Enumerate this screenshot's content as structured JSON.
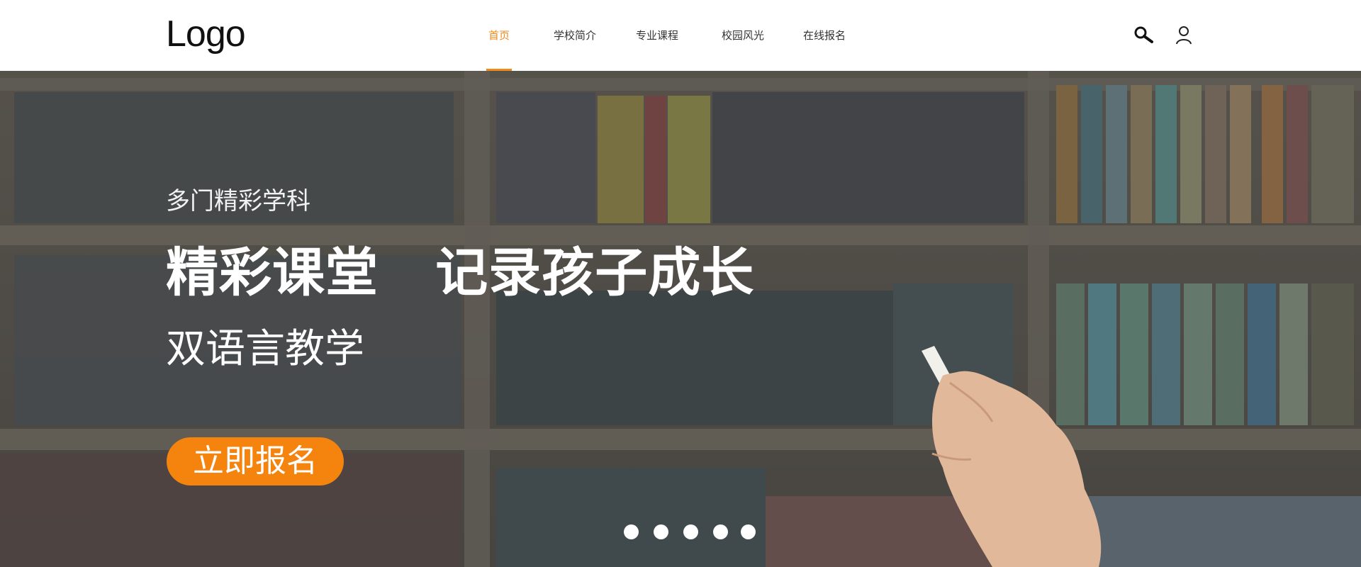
{
  "header": {
    "logo": "Logo",
    "nav": [
      {
        "label": "首页",
        "active": true
      },
      {
        "label": "学校简介",
        "active": false
      },
      {
        "label": "专业课程",
        "active": false
      },
      {
        "label": "校园风光",
        "active": false
      },
      {
        "label": "在线报名",
        "active": false
      }
    ],
    "icons": [
      "search-icon",
      "user-icon"
    ]
  },
  "hero": {
    "subtitle": "多门精彩学科",
    "title": "精彩课堂   记录孩子成长",
    "line3": "双语言教学",
    "cta_label": "立即报名",
    "slide_count": 5,
    "active_slide": 1
  },
  "colors": {
    "accent": "#f08a1a",
    "cta": "#f5840e",
    "header_bg": "#ffffff",
    "hero_bg": "#4a4742"
  }
}
